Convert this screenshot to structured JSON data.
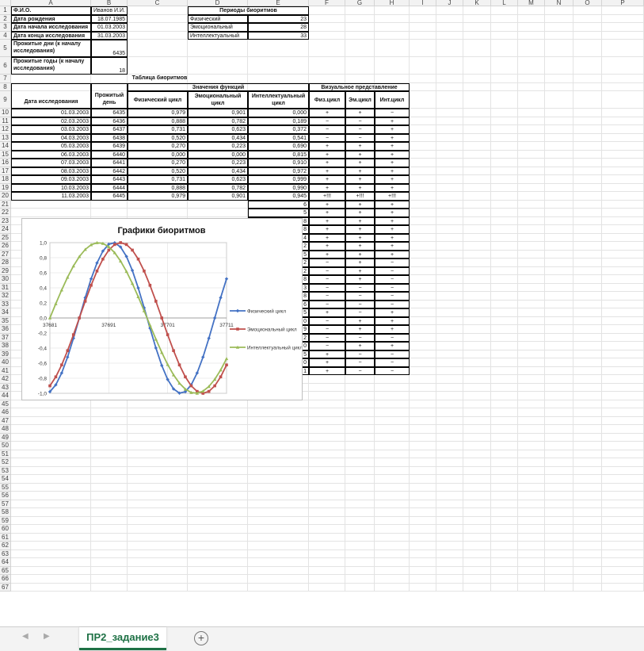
{
  "columns": [
    "A",
    "B",
    "C",
    "D",
    "E",
    "F",
    "G",
    "H",
    "I",
    "J",
    "K",
    "L",
    "M",
    "N",
    "O",
    "P"
  ],
  "row_count": 67,
  "info": {
    "fio_label": "Ф.И.О.",
    "fio_value": "Иванов И.И.",
    "birth_label": "Дата рождения",
    "birth_value": "18.07.1985",
    "start_label": "Дата начала исследования",
    "start_value": "01.03.2003",
    "end_label": "Дата конца исследования",
    "end_value": "31.03.2003",
    "days_label": "Прожитые дни (к началу исследования)",
    "days_value": "6435",
    "years_label": "Прожитые годы (к началу исследования)",
    "years_value": "18"
  },
  "periods": {
    "title": "Периоды биоритмов",
    "rows": [
      {
        "name": "Физический",
        "value": "23"
      },
      {
        "name": "Эмоциональный",
        "value": "28"
      },
      {
        "name": "Интеллектуальный",
        "value": "33"
      }
    ]
  },
  "table": {
    "title": "Таблица биоритмов",
    "values_header": "Значения функций",
    "visual_header": "Визуальное представление",
    "col_date": "Дата исследования",
    "col_day": "Прожитый день",
    "col_phys": "Физический цикл",
    "col_emo": "Эмоциональный цикл",
    "col_int": "Интеллектуальный цикл",
    "col_vphys": "Физ.цикл",
    "col_vemo": "Эм.цикл",
    "col_vint": "Инт.цикл",
    "rows": [
      {
        "date": "01.03.2003",
        "day": "6435",
        "phys": "0,979",
        "emo": "0,901",
        "int": "0,000",
        "vp": "+",
        "ve": "+",
        "vi": "−"
      },
      {
        "date": "02.03.2003",
        "day": "6436",
        "phys": "0,888",
        "emo": "0,782",
        "int": "0,189",
        "vp": "−",
        "ve": "−",
        "vi": "+"
      },
      {
        "date": "03.03.2003",
        "day": "6437",
        "phys": "0,731",
        "emo": "0,623",
        "int": "0,372",
        "vp": "−",
        "ve": "−",
        "vi": "+"
      },
      {
        "date": "04.03.2003",
        "day": "6438",
        "phys": "0,520",
        "emo": "0,434",
        "int": "0,541",
        "vp": "−",
        "ve": "−",
        "vi": "+"
      },
      {
        "date": "05.03.2003",
        "day": "6439",
        "phys": "0,270",
        "emo": "0,223",
        "int": "0,690",
        "vp": "+",
        "ve": "+",
        "vi": "+"
      },
      {
        "date": "06.03.2003",
        "day": "6440",
        "phys": "0,000",
        "emo": "0,000",
        "int": "0,815",
        "vp": "+",
        "ve": "+",
        "vi": "+"
      },
      {
        "date": "07.03.2003",
        "day": "6441",
        "phys": "0,270",
        "emo": "0,223",
        "int": "0,910",
        "vp": "+",
        "ve": "+",
        "vi": "+"
      },
      {
        "date": "08.03.2003",
        "day": "6442",
        "phys": "0,520",
        "emo": "0,434",
        "int": "0,972",
        "vp": "+",
        "ve": "+",
        "vi": "+"
      },
      {
        "date": "09.03.2003",
        "day": "6443",
        "phys": "0,731",
        "emo": "0,623",
        "int": "0,999",
        "vp": "+",
        "ve": "+",
        "vi": "+"
      },
      {
        "date": "10.03.2003",
        "day": "6444",
        "phys": "0,888",
        "emo": "0,782",
        "int": "0,990",
        "vp": "+",
        "ve": "+",
        "vi": "+"
      },
      {
        "date": "11.03.2003",
        "day": "6445",
        "phys": "0,979",
        "emo": "0,901",
        "int": "0,945",
        "vp": "+!!!",
        "ve": "+!!!",
        "vi": "+!!!"
      }
    ],
    "partial_rows": [
      {
        "e": "6",
        "vp": "+",
        "ve": "+",
        "vi": "+"
      },
      {
        "e": "5",
        "vp": "+",
        "ve": "+",
        "vi": "+"
      },
      {
        "e": "8",
        "vp": "+",
        "ve": "+",
        "vi": "+"
      },
      {
        "e": "8",
        "vp": "+",
        "ve": "+",
        "vi": "+"
      },
      {
        "e": "4",
        "vp": "+",
        "ve": "+",
        "vi": "+"
      },
      {
        "e": "2",
        "vp": "+",
        "ve": "+",
        "vi": "+"
      },
      {
        "e": "5",
        "vp": "+",
        "ve": "+",
        "vi": "+"
      },
      {
        "e": "2",
        "vp": "−",
        "ve": "+",
        "vi": "−"
      },
      {
        "e": "2",
        "vp": "−",
        "ve": "+",
        "vi": "−"
      },
      {
        "e": "8",
        "vp": "−",
        "ve": "+",
        "vi": "−"
      },
      {
        "e": "3",
        "vp": "−",
        "ve": "−",
        "vi": "−"
      },
      {
        "e": "8",
        "vp": "−",
        "ve": "−",
        "vi": "−"
      },
      {
        "e": "6",
        "vp": "−",
        "ve": "−",
        "vi": "−"
      },
      {
        "e": "5",
        "vp": "+",
        "ve": "−",
        "vi": "+"
      },
      {
        "e": "0",
        "vp": "−",
        "ve": "+",
        "vi": "+"
      },
      {
        "e": "9",
        "vp": "−",
        "ve": "+",
        "vi": "+"
      },
      {
        "e": "2",
        "vp": "−",
        "ve": "−",
        "vi": "−"
      },
      {
        "e": "0",
        "vp": "−",
        "ve": "+",
        "vi": "+"
      },
      {
        "e": "5",
        "vp": "+",
        "ve": "−",
        "vi": "−"
      },
      {
        "e": "0",
        "vp": "+",
        "ve": "−",
        "vi": "−"
      },
      {
        "e": "1",
        "vp": "+",
        "ve": "−",
        "vi": "−"
      }
    ]
  },
  "chart_data": {
    "type": "line",
    "title": "Графики биоритмов",
    "x_start": 37681,
    "x_end": 37711,
    "x_ticks": [
      37681,
      37691,
      37701,
      37711
    ],
    "ylim": [
      -1,
      1
    ],
    "y_ticks": [
      "1,0",
      "0,8",
      "0,6",
      "0,4",
      "0,2",
      "0,0",
      "-0,2",
      "-0,4",
      "-0,6",
      "-0,8",
      "-1,0"
    ],
    "legend_position": "right",
    "grid": true,
    "series": [
      {
        "name": "Физический цикл",
        "color": "#4472c4",
        "marker": "diamond",
        "period": 23,
        "phase_day": 6435
      },
      {
        "name": "Эмоциональный цикл",
        "color": "#c0504d",
        "marker": "square",
        "period": 28,
        "phase_day": 6435
      },
      {
        "name": "Интеллектуальный цикл",
        "color": "#9bbb59",
        "marker": "triangle",
        "period": 33,
        "phase_day": 6435
      }
    ]
  },
  "sheet_tab": "ПР2_задание3",
  "icons": {
    "add_sheet": "plus-circle-icon",
    "nav_prev": "triangle-left-icon",
    "nav_next": "triangle-right-icon"
  }
}
